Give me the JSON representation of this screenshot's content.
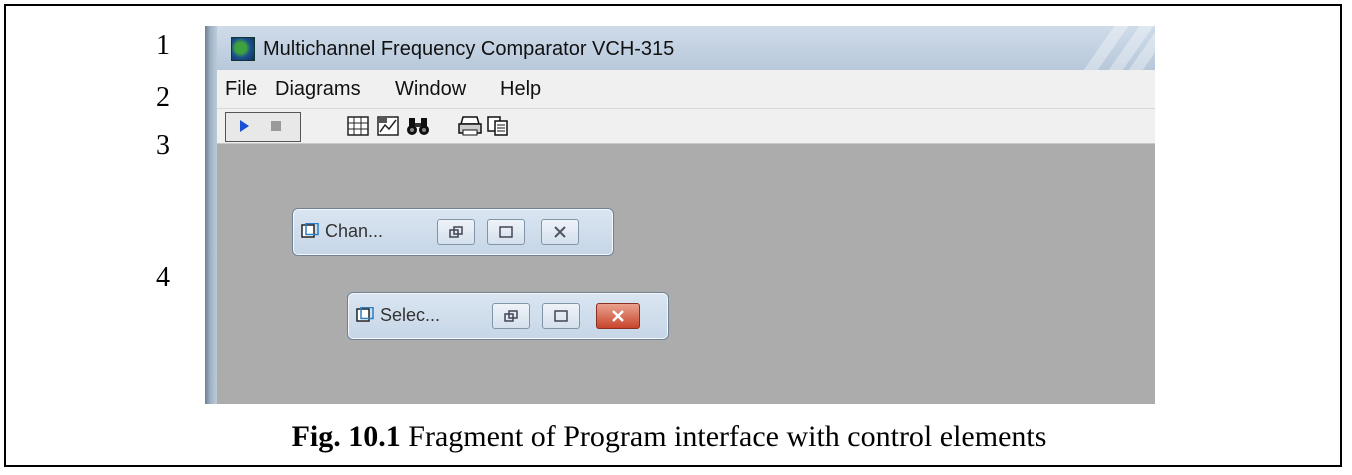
{
  "row_numbers": [
    "1",
    "2",
    "3",
    "4"
  ],
  "window": {
    "title": "Multichannel Frequency Comparator VCH-315",
    "app_icon": "app-logo-icon"
  },
  "menu": {
    "items": [
      "File",
      "Diagrams",
      "Window",
      "Help"
    ]
  },
  "toolbar": {
    "buttons": [
      {
        "name": "play-icon",
        "icon": "play"
      },
      {
        "name": "stop-icon",
        "icon": "stop"
      },
      {
        "name": "table-icon",
        "icon": "grid"
      },
      {
        "name": "chart-icon",
        "icon": "chart"
      },
      {
        "name": "binoculars-icon",
        "icon": "search"
      },
      {
        "name": "printer-icon",
        "icon": "print"
      },
      {
        "name": "copy-icon",
        "icon": "copy"
      }
    ]
  },
  "minimized_windows": [
    {
      "title": "Chan...",
      "close_style": "normal"
    },
    {
      "title": "Selec...",
      "close_style": "active"
    }
  ],
  "caption": {
    "label": "Fig. 10.1",
    "text": " Fragment of Program interface with control elements"
  },
  "colors": {
    "accent_play": "#1a4fd6",
    "close_active": "#c8452c",
    "mdi_background": "#acacac"
  }
}
